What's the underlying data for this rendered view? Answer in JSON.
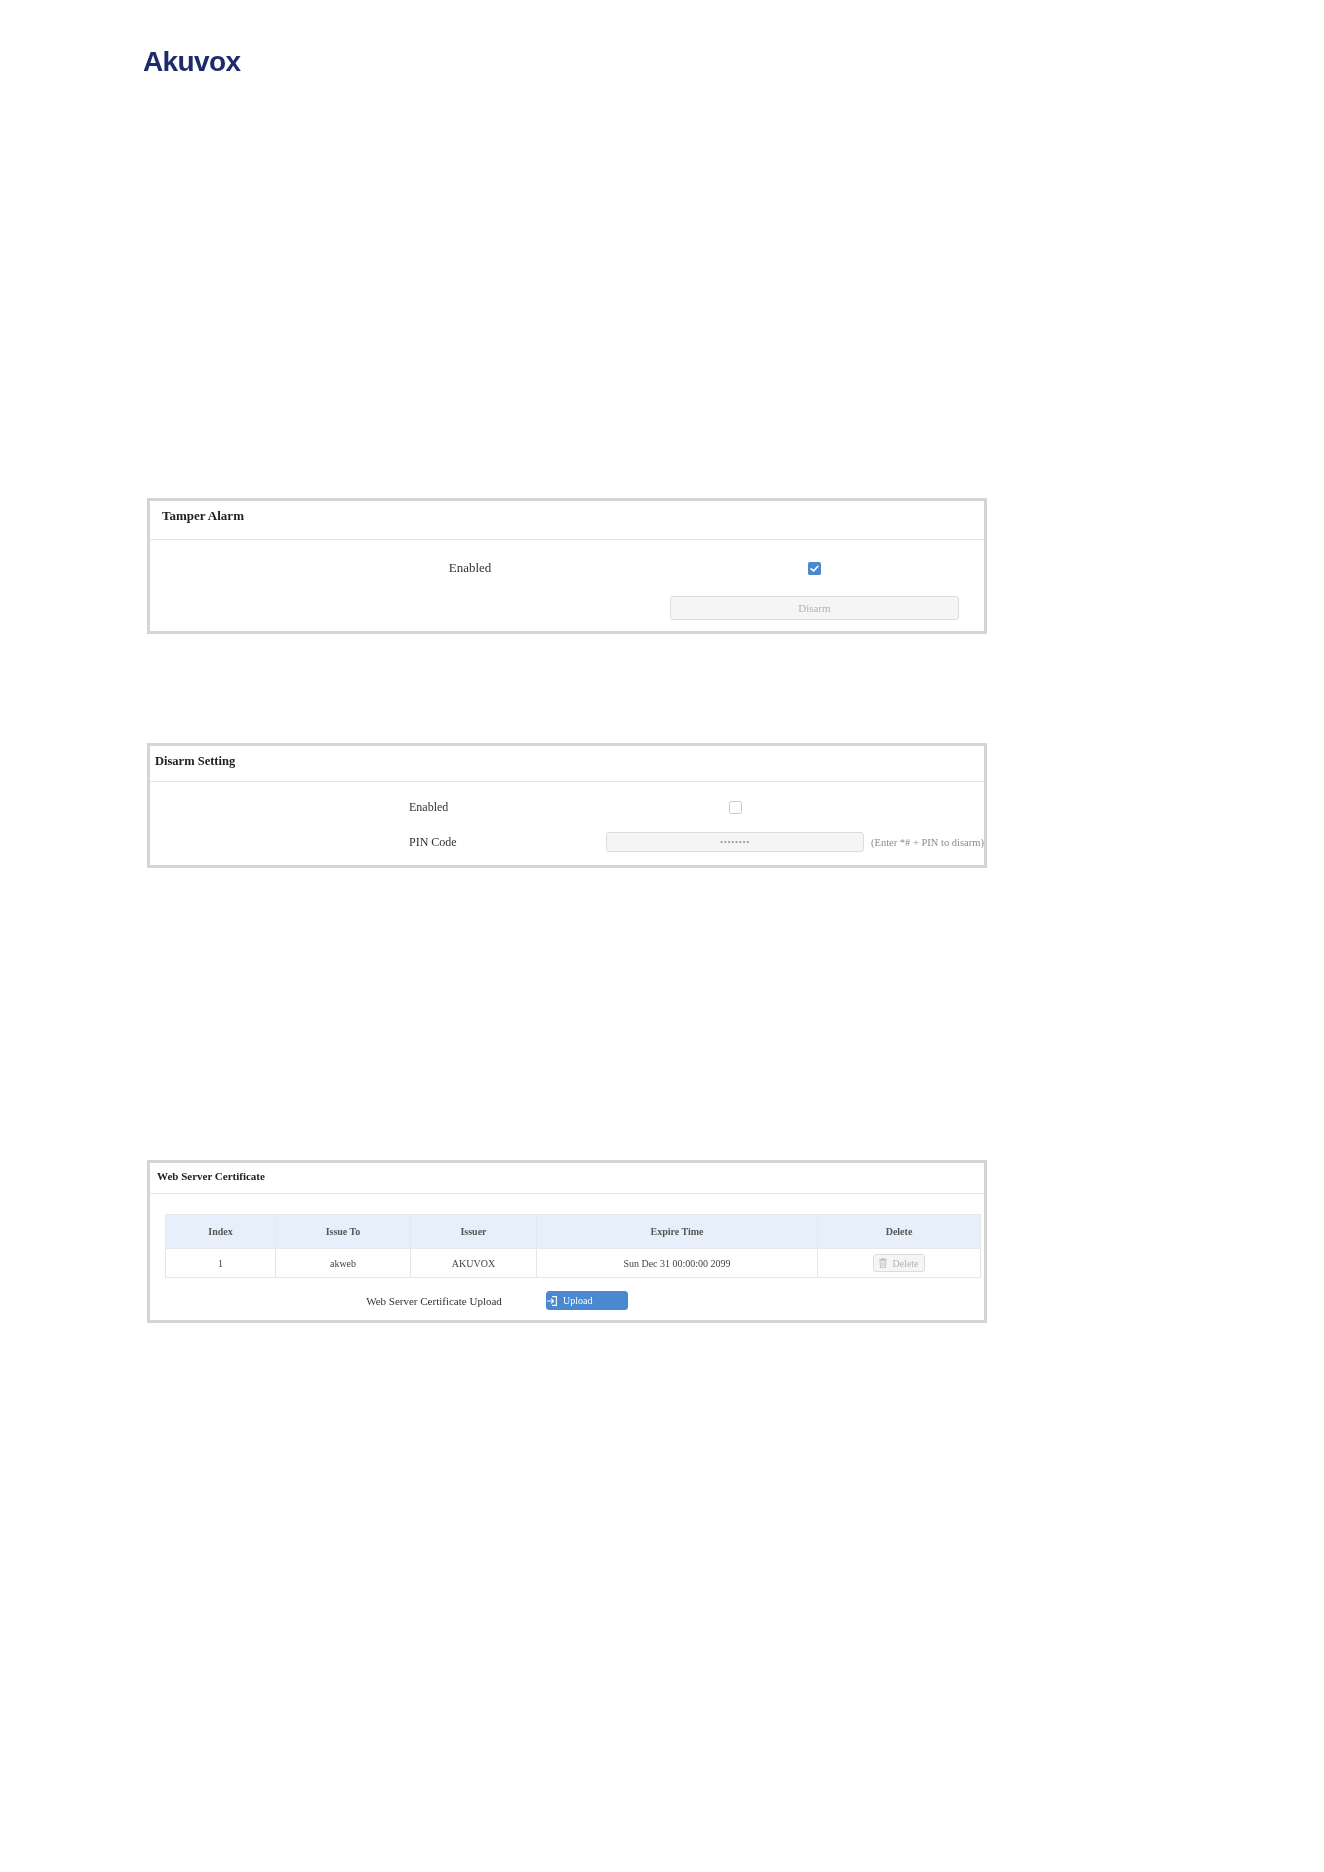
{
  "logo": {
    "text": "Akuvox"
  },
  "tamper_alarm": {
    "title": "Tamper Alarm",
    "enabled": {
      "label": "Enabled",
      "checked": true
    },
    "disarm_button": {
      "label": "Disarm",
      "disabled": true
    }
  },
  "disarm_setting": {
    "title": "Disarm Setting",
    "enabled": {
      "label": "Enabled",
      "checked": false
    },
    "pin_code": {
      "label": "PIN Code",
      "value": "••••••••",
      "disabled": true,
      "hint": "(Enter *# + PIN to disarm)"
    }
  },
  "web_server_certificate": {
    "title": "Web Server Certificate",
    "table": {
      "columns": [
        "Index",
        "Issue To",
        "Issuer",
        "Expire Time",
        "Delete"
      ],
      "rows": [
        {
          "cells": [
            "1",
            "akweb",
            "AKUVOX",
            "Sun Dec 31 00:00:00 2099"
          ],
          "delete_button": {
            "label": "Delete",
            "disabled": true
          }
        }
      ]
    },
    "upload": {
      "label": "Web Server Certificate Upload",
      "button": "Upload"
    }
  }
}
